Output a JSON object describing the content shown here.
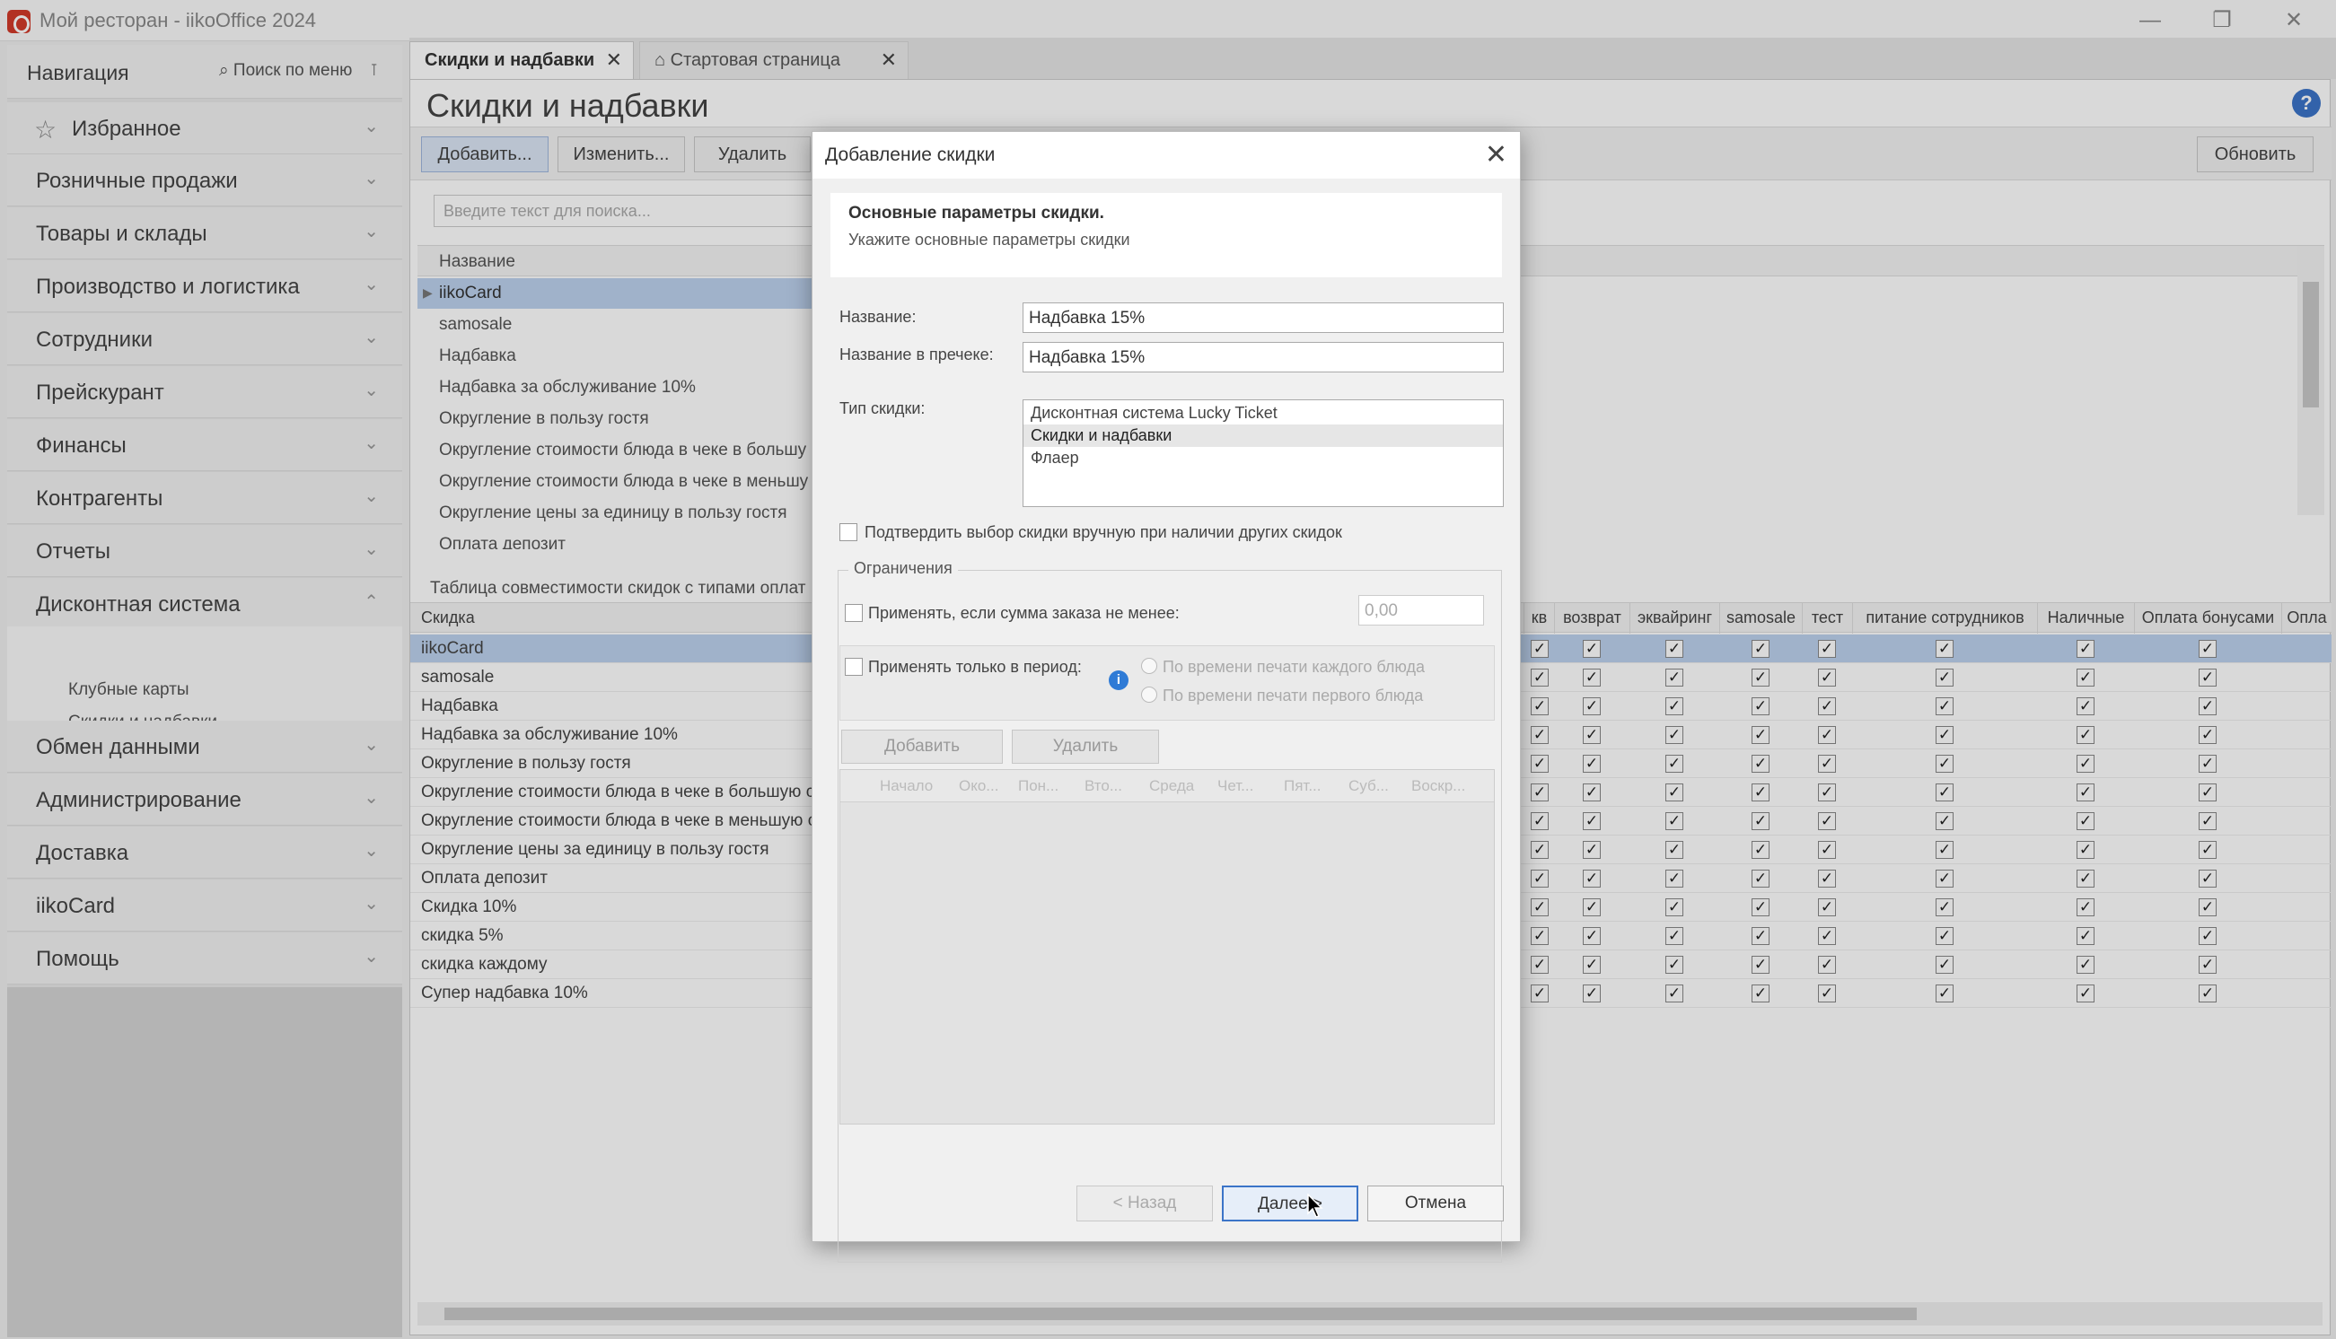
{
  "window": {
    "title": "Мой ресторан - iikoOffice 2024",
    "min": "—",
    "max": "❐",
    "close": "✕"
  },
  "nav": {
    "title": "Навигация",
    "search": "⌕ Поиск по меню",
    "pin": "⊺",
    "items": [
      {
        "label": "Избранное"
      },
      {
        "label": "Розничные продажи"
      },
      {
        "label": "Товары и склады"
      },
      {
        "label": "Производство и логистика"
      },
      {
        "label": "Сотрудники"
      },
      {
        "label": "Прейскурант"
      },
      {
        "label": "Финансы"
      },
      {
        "label": "Контрагенты"
      },
      {
        "label": "Отчеты"
      },
      {
        "label": "Дисконтная система"
      },
      {
        "label": "Обмен данными"
      },
      {
        "label": "Администрирование"
      },
      {
        "label": "Доставка"
      },
      {
        "label": "iikoCard"
      },
      {
        "label": "Помощь"
      }
    ],
    "subitems": [
      "Клубные карты",
      "Скидки и надбавки"
    ],
    "chevron_down": "⌄",
    "chevron_up": "⌃"
  },
  "tabs": [
    {
      "label": "Скидки и надбавки",
      "close": "✕"
    },
    {
      "label": "⌂ Стартовая страница",
      "close": "✕"
    }
  ],
  "main": {
    "page_title": "Скидки и надбавки",
    "help": "?",
    "toolbar": {
      "add": "Добавить...",
      "edit": "Изменить...",
      "delete": "Удалить",
      "refresh": "Обновить"
    },
    "search_placeholder": "Введите текст для поиска...",
    "list_header": "Название",
    "list_rows": [
      "iikoCard",
      "samosale",
      "Надбавка",
      "Надбавка за обслуживание 10%",
      "Округление в пользу гостя",
      "Округление стоимости блюда в чеке в большу",
      "Округление стоимости блюда в чеке в меньшу",
      "Округление цены за единицу в пользу гостя",
      "Оплата депозит"
    ],
    "compat_title": "Таблица совместимости скидок с типами оплат",
    "grid_header": "Скидка",
    "grid_columns": [
      "кв",
      "возврат",
      "эквайринг",
      "samosale",
      "тест",
      "питание сотрудников",
      "Наличные",
      "Оплата бонусами",
      "Опла"
    ],
    "grid_rows": [
      "iikoCard",
      "samosale",
      "Надбавка",
      "Надбавка за обслуживание 10%",
      "Округление в пользу гостя",
      "Округление стоимости блюда в чеке в большую ст",
      "Округление стоимости блюда в чеке в меньшую ст",
      "Округление цены за единицу в пользу гостя",
      "Оплата депозит",
      "Скидка 10%",
      "скидка 5%",
      "скидка каждому",
      "Супер надбавка 10%"
    ],
    "check": "✓"
  },
  "dialog": {
    "title": "Добавление скидки",
    "close": "✕",
    "heading": "Основные параметры скидки.",
    "subheading": "Укажите основные параметры скидки",
    "name_label": "Название:",
    "name_value": "Надбавка 15%",
    "receipt_label": "Название в пречеке:",
    "receipt_value": "Надбавка 15%",
    "type_label": "Тип скидки:",
    "types": [
      "Дисконтная система Lucky Ticket",
      "Скидки и надбавки",
      "Флаер"
    ],
    "confirm_label": "Подтвердить выбор скидки вручную при наличии других скидок",
    "limits_title": "Ограничения",
    "min_sum_label": "Применять, если сумма заказа не менее:",
    "min_sum_value": "0,00",
    "period_label": "Применять только в период:",
    "info": "i",
    "radio1": "По времени печати каждого блюда",
    "radio2": "По времени печати первого блюда",
    "period_add": "Добавить",
    "period_delete": "Удалить",
    "period_columns": [
      "Начало",
      "Око...",
      "Пон...",
      "Вто...",
      "Среда",
      "Чет...",
      "Пят...",
      "Суб...",
      "Воскр..."
    ],
    "back": "< Назад",
    "next": "Далее >",
    "cancel": "Отмена"
  }
}
